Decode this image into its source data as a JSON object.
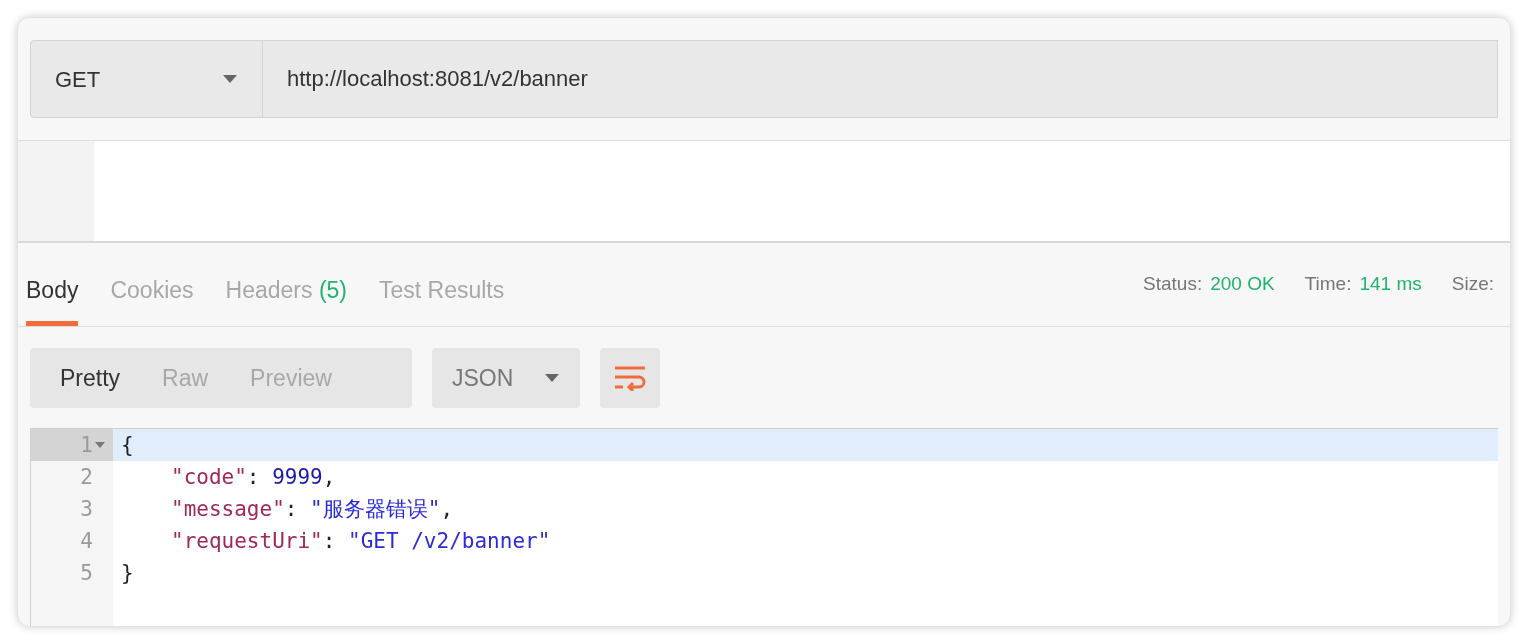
{
  "request": {
    "method": "GET",
    "url": "http://localhost:8081/v2/banner"
  },
  "response_tabs": [
    {
      "label": "Body",
      "selected": true
    },
    {
      "label": "Cookies",
      "selected": false
    },
    {
      "label": "Headers",
      "count": "(5)",
      "selected": false
    },
    {
      "label": "Test Results",
      "selected": false
    }
  ],
  "status": [
    {
      "label": "Status:",
      "value": "200 OK"
    },
    {
      "label": "Time:",
      "value": "141 ms"
    },
    {
      "label": "Size:"
    }
  ],
  "view_modes": [
    {
      "label": "Pretty",
      "selected": true
    },
    {
      "label": "Raw",
      "selected": false
    },
    {
      "label": "Preview",
      "selected": false
    }
  ],
  "format": "JSON",
  "code_lines": [
    {
      "number": "1",
      "active": true,
      "foldable": true,
      "tokens": [
        {
          "kind": "punct",
          "text": "{"
        }
      ],
      "children": [
        {
          "number": "2",
          "active": false,
          "foldable": false,
          "tokens": [
            {
              "kind": "key",
              "text": "\"code\""
            },
            {
              "kind": "punct",
              "text": ": "
            },
            {
              "kind": "number",
              "text": "9999"
            },
            {
              "kind": "punct",
              "text": ","
            }
          ]
        },
        {
          "number": "3",
          "active": false,
          "foldable": false,
          "tokens": [
            {
              "kind": "key",
              "text": "\"message\""
            },
            {
              "kind": "punct",
              "text": ": "
            },
            {
              "kind": "string",
              "text": "\"服务器错误\""
            },
            {
              "kind": "punct",
              "text": ","
            }
          ]
        },
        {
          "number": "4",
          "active": false,
          "foldable": false,
          "tokens": [
            {
              "kind": "key",
              "text": "\"requestUri\""
            },
            {
              "kind": "punct",
              "text": ": "
            },
            {
              "kind": "string",
              "text": "\"GET /v2/banner\""
            }
          ]
        }
      ]
    },
    {
      "number": "5",
      "active": false,
      "foldable": false,
      "tokens": [
        {
          "kind": "punct",
          "text": "}"
        }
      ]
    }
  ]
}
